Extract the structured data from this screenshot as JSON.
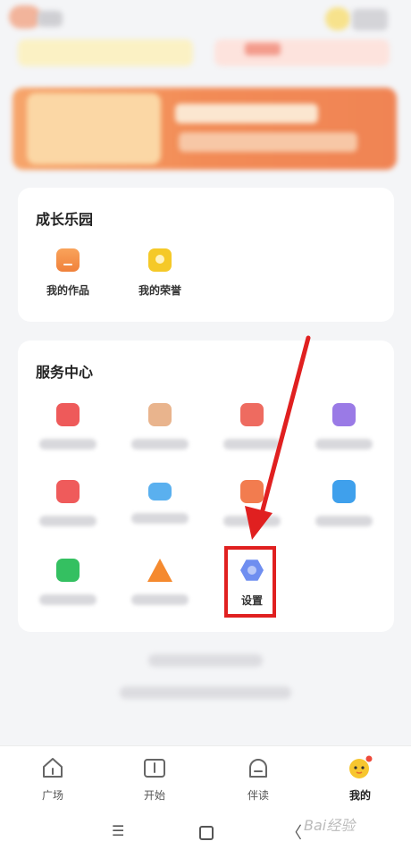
{
  "growth_card": {
    "title": "成长乐园",
    "items": [
      {
        "label": "我的作品",
        "icon": "folder-icon"
      },
      {
        "label": "我的荣誉",
        "icon": "badge-icon"
      }
    ]
  },
  "service_card": {
    "title": "服务中心",
    "items": [
      {
        "icon": "shopping-bag-icon"
      },
      {
        "icon": "package-icon"
      },
      {
        "icon": "mail-user-icon"
      },
      {
        "icon": "bag-purple-icon"
      },
      {
        "icon": "ticket-icon"
      },
      {
        "icon": "envelope-icon"
      },
      {
        "icon": "heart-icon"
      },
      {
        "icon": "document-icon"
      },
      {
        "icon": "chat-icon"
      },
      {
        "icon": "warning-icon"
      },
      {
        "label": "设置",
        "icon": "settings-icon"
      }
    ]
  },
  "tabbar": {
    "tabs": [
      {
        "label": "广场",
        "icon": "home-icon"
      },
      {
        "label": "开始",
        "icon": "book-icon"
      },
      {
        "label": "伴读",
        "icon": "companion-icon"
      },
      {
        "label": "我的",
        "icon": "mascot-icon",
        "active": true
      }
    ]
  },
  "navbar": {
    "menu_glyph": "☰",
    "back_glyph": "〈"
  },
  "watermark": "Bai经验",
  "colors": {
    "accent": "#f5c928",
    "highlight": "#e02020",
    "background": "#f4f5f7"
  }
}
